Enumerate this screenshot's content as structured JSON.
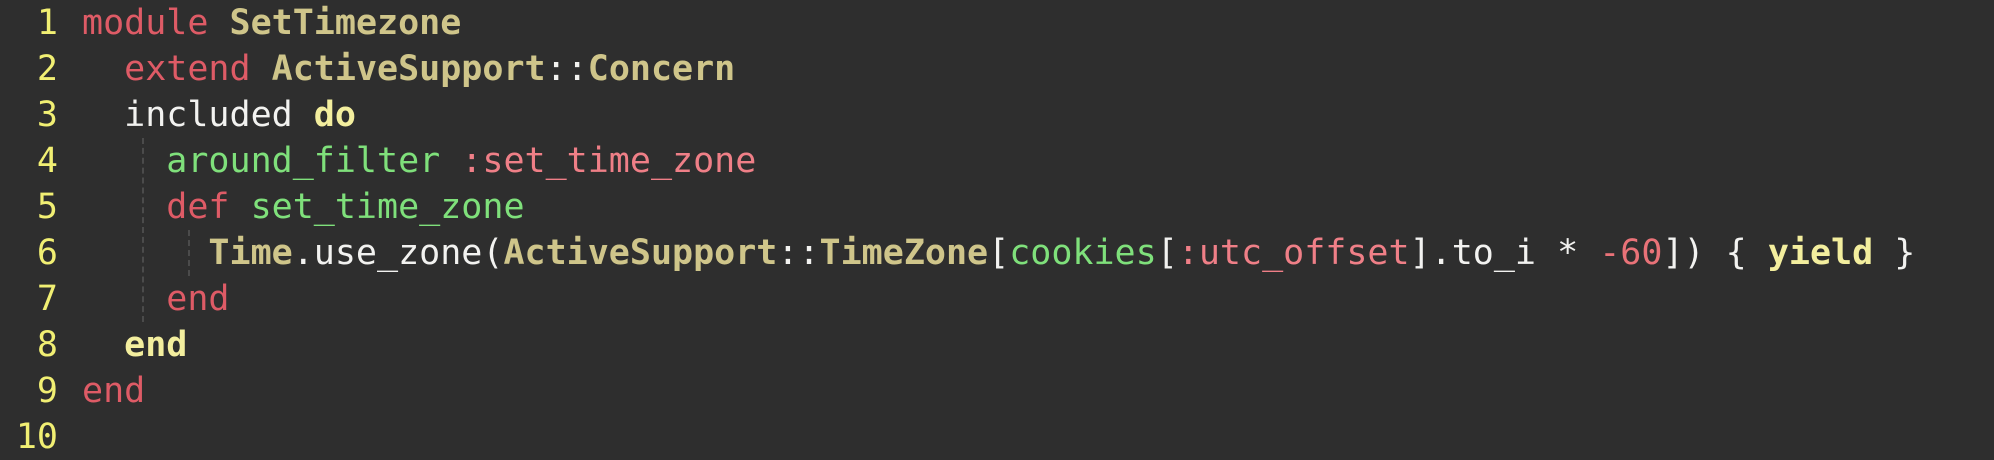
{
  "editor": {
    "language": "ruby",
    "line_numbers": [
      "1",
      "2",
      "3",
      "4",
      "5",
      "6",
      "7",
      "8",
      "9",
      "10"
    ],
    "colors": {
      "background": "#2e2e2e",
      "line_number": "#f1ef73",
      "keyword": "#de5b66",
      "constant": "#cfc58a",
      "method": "#7fe07b",
      "symbol": "#ef7f87",
      "number": "#e97278",
      "text": "#f2f2f0"
    },
    "lines": [
      [
        {
          "text": "module ",
          "cls": "kw"
        },
        {
          "text": "SetTimezone",
          "cls": "const"
        }
      ],
      [
        {
          "text": "  extend ",
          "cls": "kw"
        },
        {
          "text": "ActiveSupport",
          "cls": "const"
        },
        {
          "text": "::",
          "cls": "plain"
        },
        {
          "text": "Concern",
          "cls": "const"
        }
      ],
      [
        {
          "text": "  included ",
          "cls": "plain"
        },
        {
          "text": "do",
          "cls": "bold"
        }
      ],
      [
        {
          "text": "    around_filter ",
          "cls": "method"
        },
        {
          "text": ":set_time_zone",
          "cls": "symbol"
        }
      ],
      [
        {
          "text": "    def ",
          "cls": "kw"
        },
        {
          "text": "set_time_zone",
          "cls": "method"
        }
      ],
      [
        {
          "text": "      Time",
          "cls": "const"
        },
        {
          "text": ".use_zone(",
          "cls": "plain"
        },
        {
          "text": "ActiveSupport",
          "cls": "const"
        },
        {
          "text": "::",
          "cls": "plain"
        },
        {
          "text": "TimeZone",
          "cls": "const"
        },
        {
          "text": "[",
          "cls": "plain"
        },
        {
          "text": "cookies",
          "cls": "method"
        },
        {
          "text": "[",
          "cls": "plain"
        },
        {
          "text": ":utc_offset",
          "cls": "symbol"
        },
        {
          "text": "].to_i * ",
          "cls": "plain"
        },
        {
          "text": "-60",
          "cls": "num"
        },
        {
          "text": "]) { ",
          "cls": "plain"
        },
        {
          "text": "yield",
          "cls": "bold"
        },
        {
          "text": " }",
          "cls": "plain"
        }
      ],
      [
        {
          "text": "    end",
          "cls": "kw"
        }
      ],
      [
        {
          "text": "  end",
          "cls": "bold"
        }
      ],
      [
        {
          "text": "end",
          "cls": "kw"
        }
      ],
      []
    ]
  }
}
